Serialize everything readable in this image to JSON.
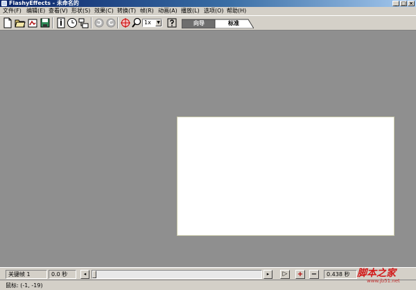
{
  "window": {
    "title": "FlashyEffects - 未命名的",
    "minimize_glyph": "_",
    "maximize_glyph": "□",
    "close_glyph": "×"
  },
  "menu": [
    {
      "label": "文件(F)"
    },
    {
      "label": "编辑(E)"
    },
    {
      "label": "查看(V)"
    },
    {
      "label": "形状(S)"
    },
    {
      "label": "效果(C)"
    },
    {
      "label": "转换(T)"
    },
    {
      "label": "帧(R)"
    },
    {
      "label": "动画(A)"
    },
    {
      "label": "播放(L)"
    },
    {
      "label": "选项(O)"
    },
    {
      "label": "帮助(H)"
    }
  ],
  "toolbar": {
    "zoom_value": "1x",
    "tabs": [
      {
        "label": "向导",
        "active": false
      },
      {
        "label": "标准",
        "active": true
      }
    ]
  },
  "timeline": {
    "keyframe_text": "关键帧 1",
    "time_text": "0.0 秒",
    "duration_text": "0.438 秒",
    "play_glyph": "▷",
    "add_glyph": "+",
    "remove_glyph": "−",
    "scroll_left_glyph": "◂",
    "scroll_right_glyph": "▸"
  },
  "status": {
    "mouse_text": "鼠标:  (-1, -19)"
  },
  "watermark": {
    "main": "脚本之家",
    "sub": "www.jb51.net"
  },
  "colors": {
    "workspace": "#8f8f8f",
    "stage": "#ffffff",
    "title_gradient_start": "#0a246a",
    "active_tab": "#ffffff",
    "inactive_tab": "#6e6e6e"
  }
}
